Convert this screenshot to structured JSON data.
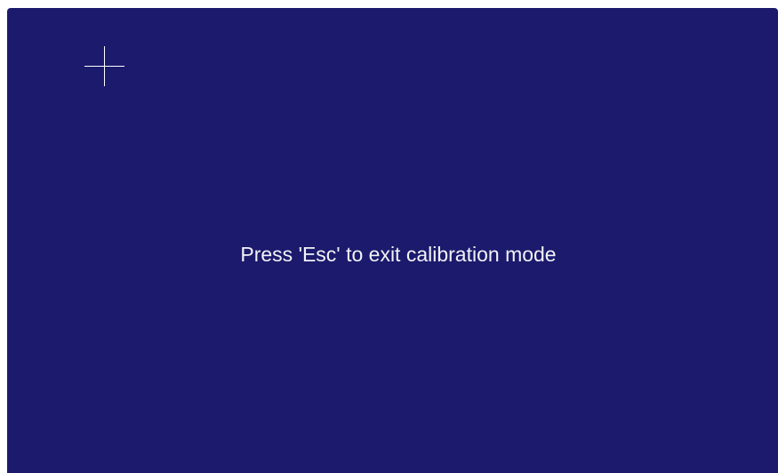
{
  "calibration": {
    "message": "Press 'Esc' to exit calibration mode",
    "target_icon": "crosshair-icon",
    "background_color": "#1b1a6c",
    "foreground_color": "#ffffff"
  }
}
